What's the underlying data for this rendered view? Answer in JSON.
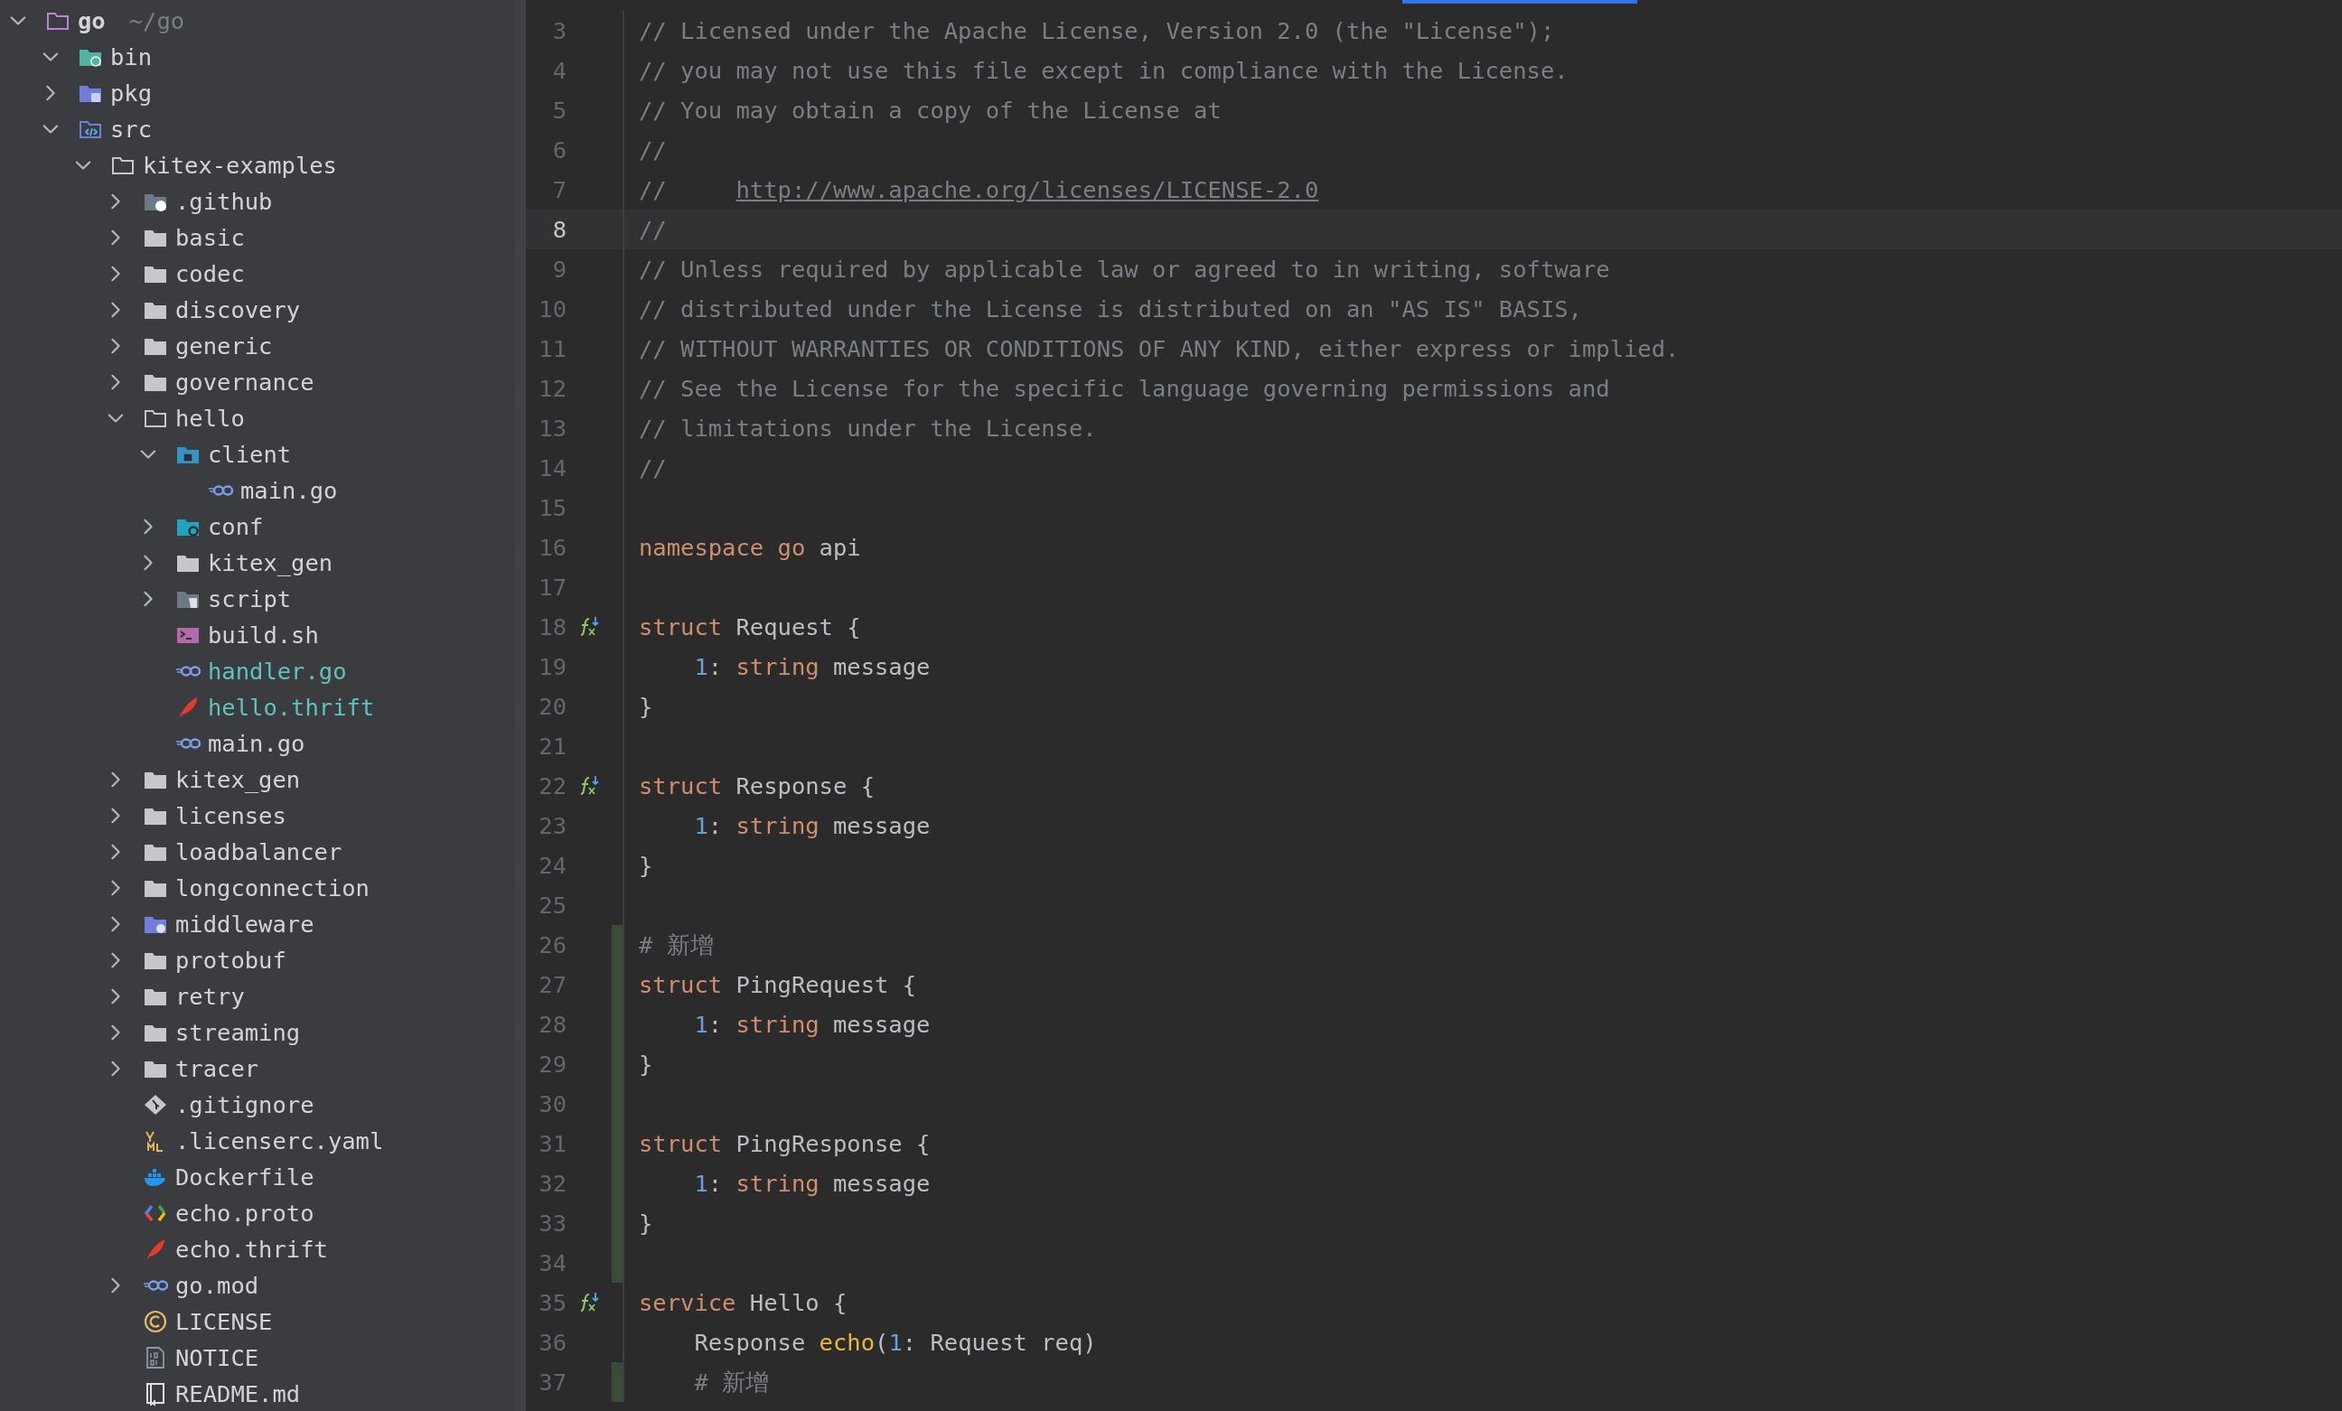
{
  "project_tree": [
    {
      "name": "go",
      "hint": "~/go",
      "kind": "folder-outline",
      "expanded": true,
      "modified": false,
      "bold": true,
      "children": [
        {
          "name": "bin",
          "kind": "folder-binary",
          "expanded": true,
          "modified": false
        },
        {
          "name": "pkg",
          "kind": "folder-package",
          "expanded": false,
          "modified": false
        },
        {
          "name": "src",
          "kind": "folder-source",
          "expanded": true,
          "modified": false,
          "children": [
            {
              "name": "kitex-examples",
              "kind": "folder-outline",
              "expanded": true,
              "modified": false,
              "children": [
                {
                  "name": ".github",
                  "kind": "folder-github",
                  "expanded": false,
                  "modified": false
                },
                {
                  "name": "basic",
                  "kind": "folder",
                  "expanded": false,
                  "modified": false
                },
                {
                  "name": "codec",
                  "kind": "folder",
                  "expanded": false,
                  "modified": false
                },
                {
                  "name": "discovery",
                  "kind": "folder",
                  "expanded": false,
                  "modified": false
                },
                {
                  "name": "generic",
                  "kind": "folder",
                  "expanded": false,
                  "modified": false
                },
                {
                  "name": "governance",
                  "kind": "folder",
                  "expanded": false,
                  "modified": false
                },
                {
                  "name": "hello",
                  "kind": "folder-outline",
                  "expanded": true,
                  "modified": false,
                  "children": [
                    {
                      "name": "client",
                      "kind": "folder-client",
                      "expanded": true,
                      "modified": false,
                      "children": [
                        {
                          "name": "main.go",
                          "kind": "go-file",
                          "modified": false
                        }
                      ]
                    },
                    {
                      "name": "conf",
                      "kind": "folder-config",
                      "expanded": false,
                      "modified": false
                    },
                    {
                      "name": "kitex_gen",
                      "kind": "folder",
                      "expanded": false,
                      "modified": false
                    },
                    {
                      "name": "script",
                      "kind": "folder-script",
                      "expanded": false,
                      "modified": false
                    },
                    {
                      "name": "build.sh",
                      "kind": "shell-file",
                      "modified": false
                    },
                    {
                      "name": "handler.go",
                      "kind": "go-file",
                      "modified": true
                    },
                    {
                      "name": "hello.thrift",
                      "kind": "thrift-file",
                      "modified": true
                    },
                    {
                      "name": "main.go",
                      "kind": "go-file",
                      "modified": false
                    }
                  ]
                },
                {
                  "name": "kitex_gen",
                  "kind": "folder",
                  "expanded": false,
                  "modified": false
                },
                {
                  "name": "licenses",
                  "kind": "folder",
                  "expanded": false,
                  "modified": false
                },
                {
                  "name": "loadbalancer",
                  "kind": "folder",
                  "expanded": false,
                  "modified": false
                },
                {
                  "name": "longconnection",
                  "kind": "folder",
                  "expanded": false,
                  "modified": false
                },
                {
                  "name": "middleware",
                  "kind": "folder-plugin",
                  "expanded": false,
                  "modified": false
                },
                {
                  "name": "protobuf",
                  "kind": "folder",
                  "expanded": false,
                  "modified": false
                },
                {
                  "name": "retry",
                  "kind": "folder",
                  "expanded": false,
                  "modified": false
                },
                {
                  "name": "streaming",
                  "kind": "folder",
                  "expanded": false,
                  "modified": false
                },
                {
                  "name": "tracer",
                  "kind": "folder",
                  "expanded": false,
                  "modified": false
                },
                {
                  "name": ".gitignore",
                  "kind": "git-file",
                  "modified": false
                },
                {
                  "name": ".licenserc.yaml",
                  "kind": "yaml-file",
                  "modified": false
                },
                {
                  "name": "Dockerfile",
                  "kind": "docker-file",
                  "modified": false
                },
                {
                  "name": "echo.proto",
                  "kind": "proto-file",
                  "modified": false
                },
                {
                  "name": "echo.thrift",
                  "kind": "thrift-file",
                  "modified": false
                },
                {
                  "name": "go.mod",
                  "kind": "go-file",
                  "expanded": false,
                  "modified": false
                },
                {
                  "name": "LICENSE",
                  "kind": "license-file",
                  "modified": false
                },
                {
                  "name": "NOTICE",
                  "kind": "text-file",
                  "modified": false
                },
                {
                  "name": "README.md",
                  "kind": "readme-file",
                  "modified": false
                }
              ]
            }
          ]
        }
      ]
    }
  ],
  "editor": {
    "lines": [
      {
        "number": "3",
        "current": false,
        "changed": false,
        "tokens": [
          {
            "kind": "comment",
            "text": "// Licensed under the Apache License, Version 2.0 (the \"License\");"
          }
        ]
      },
      {
        "number": "4",
        "current": false,
        "changed": false,
        "tokens": [
          {
            "kind": "comment",
            "text": "// you may not use this file except in compliance with the License."
          }
        ]
      },
      {
        "number": "5",
        "current": false,
        "changed": false,
        "tokens": [
          {
            "kind": "comment",
            "text": "// You may obtain a copy of the License at"
          }
        ]
      },
      {
        "number": "6",
        "current": false,
        "changed": false,
        "tokens": [
          {
            "kind": "comment",
            "text": "//"
          }
        ]
      },
      {
        "number": "7",
        "current": false,
        "changed": false,
        "tokens": [
          {
            "kind": "comment",
            "text": "//     "
          },
          {
            "kind": "link",
            "text": "http://www.apache.org/licenses/LICENSE-2.0"
          }
        ]
      },
      {
        "number": "8",
        "current": true,
        "changed": false,
        "tokens": [
          {
            "kind": "comment",
            "text": "//"
          }
        ]
      },
      {
        "number": "9",
        "current": false,
        "changed": false,
        "tokens": [
          {
            "kind": "comment",
            "text": "// Unless required by applicable law or agreed to in writing, software"
          }
        ]
      },
      {
        "number": "10",
        "current": false,
        "changed": false,
        "tokens": [
          {
            "kind": "comment",
            "text": "// distributed under the License is distributed on an \"AS IS\" BASIS,"
          }
        ]
      },
      {
        "number": "11",
        "current": false,
        "changed": false,
        "tokens": [
          {
            "kind": "comment",
            "text": "// WITHOUT WARRANTIES OR CONDITIONS OF ANY KIND, either express or implied."
          }
        ]
      },
      {
        "number": "12",
        "current": false,
        "changed": false,
        "tokens": [
          {
            "kind": "comment",
            "text": "// See the License for the specific language governing permissions and"
          }
        ]
      },
      {
        "number": "13",
        "current": false,
        "changed": false,
        "tokens": [
          {
            "kind": "comment",
            "text": "// limitations under the License."
          }
        ]
      },
      {
        "number": "14",
        "current": false,
        "changed": false,
        "tokens": [
          {
            "kind": "comment",
            "text": "//"
          }
        ]
      },
      {
        "number": "15",
        "current": false,
        "changed": false
      },
      {
        "number": "16",
        "current": false,
        "changed": false,
        "tokens": [
          {
            "kind": "keyword",
            "text": "namespace go"
          },
          {
            "kind": "plain",
            "text": " api"
          }
        ]
      },
      {
        "number": "17",
        "current": false,
        "changed": false
      },
      {
        "number": "18",
        "current": false,
        "changed": false,
        "marker": true,
        "tokens": [
          {
            "kind": "keyword",
            "text": "struct"
          },
          {
            "kind": "plain",
            "text": " Request {"
          }
        ]
      },
      {
        "number": "19",
        "current": false,
        "changed": false,
        "tokens": [
          {
            "kind": "number",
            "text": "    1"
          },
          {
            "kind": "plain",
            "text": ": "
          },
          {
            "kind": "keyword",
            "text": "string"
          },
          {
            "kind": "plain",
            "text": " message"
          }
        ]
      },
      {
        "number": "20",
        "current": false,
        "changed": false,
        "tokens": [
          {
            "kind": "plain",
            "text": "}"
          }
        ]
      },
      {
        "number": "21",
        "current": false,
        "changed": false
      },
      {
        "number": "22",
        "current": false,
        "changed": false,
        "marker": true,
        "tokens": [
          {
            "kind": "keyword",
            "text": "struct"
          },
          {
            "kind": "plain",
            "text": " Response {"
          }
        ]
      },
      {
        "number": "23",
        "current": false,
        "changed": false,
        "tokens": [
          {
            "kind": "number",
            "text": "    1"
          },
          {
            "kind": "plain",
            "text": ": "
          },
          {
            "kind": "keyword",
            "text": "string"
          },
          {
            "kind": "plain",
            "text": " message"
          }
        ]
      },
      {
        "number": "24",
        "current": false,
        "changed": false,
        "tokens": [
          {
            "kind": "plain",
            "text": "}"
          }
        ]
      },
      {
        "number": "25",
        "current": false,
        "changed": false
      },
      {
        "number": "26",
        "current": false,
        "changed": true,
        "tokens": [
          {
            "kind": "comment",
            "text": "# 新增"
          }
        ]
      },
      {
        "number": "27",
        "current": false,
        "changed": true,
        "tokens": [
          {
            "kind": "keyword",
            "text": "struct"
          },
          {
            "kind": "plain",
            "text": " PingRequest {"
          }
        ]
      },
      {
        "number": "28",
        "current": false,
        "changed": true,
        "tokens": [
          {
            "kind": "number",
            "text": "    1"
          },
          {
            "kind": "plain",
            "text": ": "
          },
          {
            "kind": "keyword",
            "text": "string"
          },
          {
            "kind": "plain",
            "text": " message"
          }
        ]
      },
      {
        "number": "29",
        "current": false,
        "changed": true,
        "tokens": [
          {
            "kind": "plain",
            "text": "}"
          }
        ]
      },
      {
        "number": "30",
        "current": false,
        "changed": true
      },
      {
        "number": "31",
        "current": false,
        "changed": true,
        "tokens": [
          {
            "kind": "keyword",
            "text": "struct"
          },
          {
            "kind": "plain",
            "text": " PingResponse {"
          }
        ]
      },
      {
        "number": "32",
        "current": false,
        "changed": true,
        "tokens": [
          {
            "kind": "number",
            "text": "    1"
          },
          {
            "kind": "plain",
            "text": ": "
          },
          {
            "kind": "keyword",
            "text": "string"
          },
          {
            "kind": "plain",
            "text": " message"
          }
        ]
      },
      {
        "number": "33",
        "current": false,
        "changed": true,
        "tokens": [
          {
            "kind": "plain",
            "text": "}"
          }
        ]
      },
      {
        "number": "34",
        "current": false,
        "changed": true
      },
      {
        "number": "35",
        "current": false,
        "changed": false,
        "marker": true,
        "tokens": [
          {
            "kind": "keyword",
            "text": "service"
          },
          {
            "kind": "plain",
            "text": " Hello {"
          }
        ]
      },
      {
        "number": "36",
        "current": false,
        "changed": false,
        "tokens": [
          {
            "kind": "plain",
            "text": "    Response "
          },
          {
            "kind": "function",
            "text": "echo"
          },
          {
            "kind": "plain",
            "text": "("
          },
          {
            "kind": "number",
            "text": "1"
          },
          {
            "kind": "plain",
            "text": ": Request req)"
          }
        ]
      },
      {
        "number": "37",
        "current": false,
        "changed": true,
        "tokens": [
          {
            "kind": "comment",
            "text": "    # 新增"
          }
        ]
      }
    ]
  }
}
